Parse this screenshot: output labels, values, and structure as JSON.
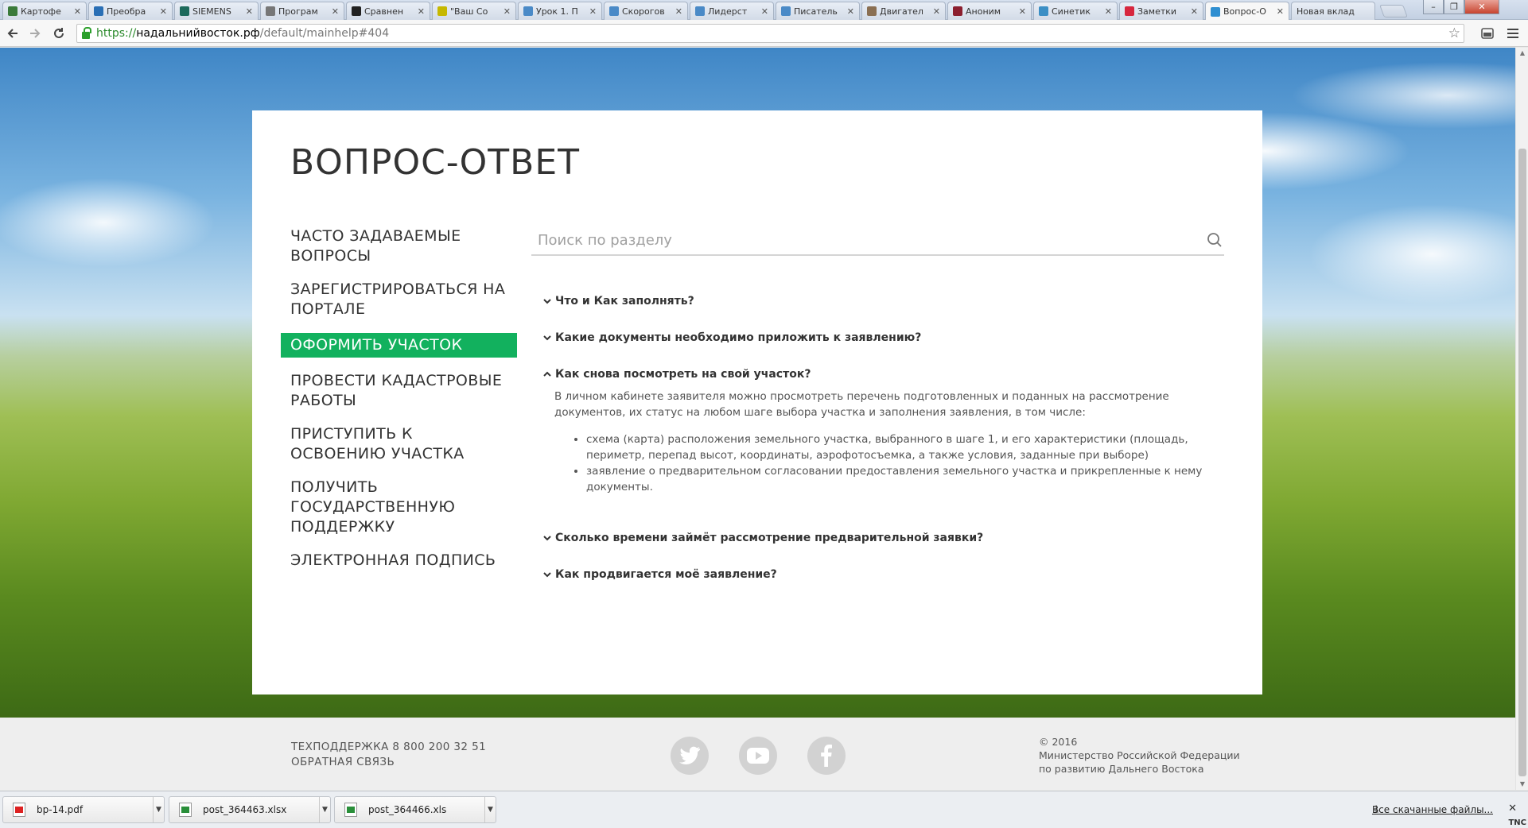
{
  "browser": {
    "tabs": [
      {
        "title": "Картофе",
        "color": "#3a7a3a"
      },
      {
        "title": "Преобра",
        "color": "#2a6fb5"
      },
      {
        "title": "SIEMENS",
        "color": "#1d6a5c"
      },
      {
        "title": "Програм",
        "color": "#777777"
      },
      {
        "title": "Сравнен",
        "color": "#222222"
      },
      {
        "title": "\"Ваш Со",
        "color": "#c6b800"
      },
      {
        "title": "Урок 1. П",
        "color": "#4a8ac7"
      },
      {
        "title": "Скорогов",
        "color": "#4a8ac7"
      },
      {
        "title": "Лидерст",
        "color": "#4a8ac7"
      },
      {
        "title": "Писатель",
        "color": "#4a8ac7"
      },
      {
        "title": "Двигател",
        "color": "#8a6f52"
      },
      {
        "title": "Аноним",
        "color": "#8b1e2e"
      },
      {
        "title": "Синетик",
        "color": "#3b8fc5"
      },
      {
        "title": "Заметки",
        "color": "#d7263d"
      },
      {
        "title": "Вопрос-О",
        "color": "#2f8fd1"
      },
      {
        "title": "Новая вклад",
        "color": ""
      }
    ],
    "close_glyph": "✕",
    "url": {
      "scheme": "https://",
      "host": "надальнийвосток.рф",
      "path": "/default/mainhelp#404"
    }
  },
  "page": {
    "title": "ВОПРОС-ОТВЕТ",
    "nav": [
      "ЧАСТО ЗАДАВАЕМЫЕ ВОПРОСЫ",
      "ЗАРЕГИСТРИРОВАТЬСЯ НА ПОРТАЛЕ",
      "ОФОРМИТЬ УЧАСТОК",
      "ПРОВЕСТИ КАДАСТРОВЫЕ РАБОТЫ",
      "ПРИСТУПИТЬ К ОСВОЕНИЮ УЧАСТКА",
      "ПОЛУЧИТЬ ГОСУДАРСТВЕННУЮ ПОДДЕРЖКУ",
      "ЭЛЕКТРОННАЯ ПОДПИСЬ"
    ],
    "active_nav": 2,
    "accent_color": "#12b15e",
    "search": {
      "placeholder": "Поиск по разделу",
      "value": ""
    },
    "faq": [
      {
        "question": "Что и Как заполнять?",
        "expanded": false
      },
      {
        "question": "Какие документы необходимо приложить к заявлению?",
        "expanded": false
      },
      {
        "question": "Как снова посмотреть на свой участок?",
        "expanded": true,
        "answer": "В личном кабинете заявителя можно просмотреть перечень подготовленных и поданных на рассмотрение документов, их статус на любом шаге выбора участка и заполнения заявления, в том числе:",
        "bullets": [
          "схема (карта) расположения земельного участка, выбранного в шаге 1, и его характеристики (площадь, периметр, перепад высот, координаты, аэрофотосъемка, а также условия, заданные при выборе)",
          "заявление о предварительном согласовании предоставления земельного участка и прикрепленные к нему документы."
        ]
      },
      {
        "question": "Сколько времени займёт рассмотрение предварительной заявки?",
        "expanded": false
      },
      {
        "question": "Как продвигается моё заявление?",
        "expanded": false
      }
    ]
  },
  "footer": {
    "support": "ТЕХПОДДЕРЖКА 8 800 200 32 51",
    "feedback": "ОБРАТНАЯ СВЯЗЬ",
    "social": [
      "twitter-icon",
      "youtube-icon",
      "facebook-icon"
    ],
    "copyright": "© 2016",
    "org_line1": "Министерство Российской Федерации",
    "org_line2": "по развитию Дальнего Востока"
  },
  "downloads": {
    "items": [
      {
        "name": "bp-14.pdf",
        "type": "pdf"
      },
      {
        "name": "post_364463.xlsx",
        "type": "xls"
      },
      {
        "name": "post_364466.xls",
        "type": "xls"
      }
    ],
    "all_label": "Все скачанные файлы...",
    "close_glyph": "✕"
  },
  "watermark": "TNC"
}
